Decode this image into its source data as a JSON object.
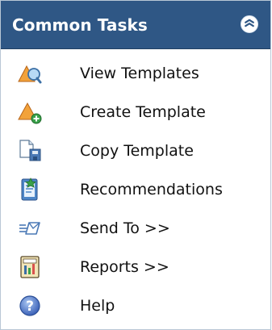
{
  "panel": {
    "title": "Common Tasks",
    "collapse_icon": "double-chevron-up-icon",
    "colors": {
      "header_bg": "#2f5785",
      "header_text": "#ffffff",
      "border": "#b9c7d6"
    }
  },
  "tasks": [
    {
      "label": "View Templates",
      "icon": "view-templates-icon"
    },
    {
      "label": "Create Template",
      "icon": "create-template-icon"
    },
    {
      "label": "Copy Template",
      "icon": "copy-template-icon"
    },
    {
      "label": "Recommendations",
      "icon": "recommendations-icon"
    },
    {
      "label": "Send To >>",
      "icon": "send-to-icon"
    },
    {
      "label": "Reports >>",
      "icon": "reports-icon"
    },
    {
      "label": "Help",
      "icon": "help-icon"
    }
  ]
}
